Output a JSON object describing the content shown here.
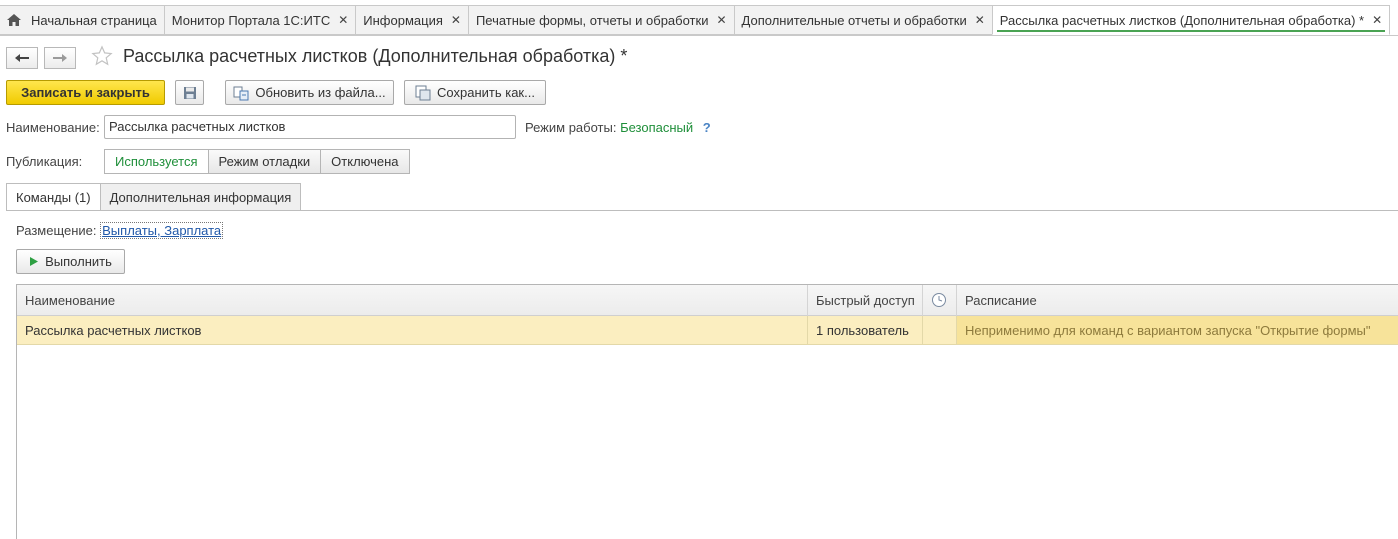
{
  "tabs": [
    {
      "label": "Начальная страница",
      "home": true,
      "closable": false
    },
    {
      "label": "Монитор Портала 1С:ИТС",
      "closable": true
    },
    {
      "label": "Информация",
      "closable": true
    },
    {
      "label": "Печатные формы, отчеты и обработки",
      "closable": true
    },
    {
      "label": "Дополнительные отчеты и обработки",
      "closable": true
    },
    {
      "label": "Рассылка расчетных листков (Дополнительная обработка) *",
      "closable": true,
      "active": true
    }
  ],
  "close_glyph": "✕",
  "header": {
    "title": "Рассылка расчетных листков (Дополнительная обработка) *",
    "back_glyph": "🡐",
    "forward_glyph": "🡒"
  },
  "toolbar": {
    "save_close": "Записать и закрыть",
    "update_from_file": "Обновить из файла...",
    "save_as": "Сохранить как..."
  },
  "fields": {
    "name_label": "Наименование:",
    "name_value": "Рассылка расчетных листков",
    "mode_label": "Режим работы:",
    "mode_value": "Безопасный",
    "help": "?",
    "publication_label": "Публикация:",
    "publication_options": [
      "Используется",
      "Режим отладки",
      "Отключена"
    ],
    "publication_selected": "Используется"
  },
  "form_tabs": [
    "Команды (1)",
    "Дополнительная информация"
  ],
  "commands": {
    "placement_label": "Размещение:",
    "placement_value": "Выплаты, Зарплата",
    "run_button": "Выполнить",
    "columns": [
      "Наименование",
      "Быстрый доступ",
      "",
      "Расписание"
    ],
    "rows": [
      {
        "name": "Рассылка расчетных листков",
        "quick_access": "1 пользователь",
        "schedule": "Неприменимо для команд с вариантом запуска \"Открытие формы\""
      }
    ]
  },
  "colors": {
    "accent_green": "#1f8f3a",
    "primary_button": "#f5d200",
    "selected_row": "#fbeec0",
    "link": "#2158a8"
  }
}
